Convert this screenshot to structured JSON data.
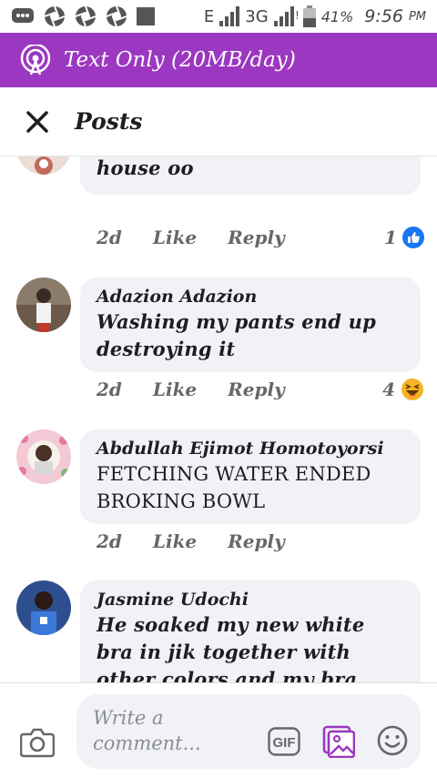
{
  "status_bar": {
    "network_type_1": "E",
    "network_type_2": "3G",
    "battery": "41%",
    "time": "9:56",
    "ampm": "PM"
  },
  "banner": {
    "text": "Text Only (20MB/day)",
    "icon": "free-mode-broadcast-icon",
    "color": "#9b37c0"
  },
  "header": {
    "title": "Posts",
    "close_icon": "close-icon"
  },
  "comments": [
    {
      "author": "",
      "text": "My can't  do anything in the house  oo",
      "time": "2d",
      "like_label": "Like",
      "reply_label": "Reply",
      "reaction_count": "1",
      "reaction_icon": "like-reaction-icon"
    },
    {
      "author": "Adazion Adazion",
      "text": "Washing my pants end up destroying it",
      "time": "2d",
      "like_label": "Like",
      "reply_label": "Reply",
      "reaction_count": "4",
      "reaction_icon": "haha-reaction-icon"
    },
    {
      "author": "Abdullah Ejimot Homotoyorsi",
      "text": "FETCHING WATER ENDED BROKING BOWL",
      "time": "2d",
      "like_label": "Like",
      "reply_label": "Reply",
      "reaction_count": "",
      "reaction_icon": ""
    },
    {
      "author": "Jasmine Udochi",
      "text": "He soaked my new white bra in jik together with other colors and my bra came out many",
      "time": "",
      "like_label": "",
      "reply_label": "",
      "reaction_count": "",
      "reaction_icon": ""
    }
  ],
  "composer": {
    "placeholder": "Write a comment...",
    "gif_label": "GIF",
    "camera_icon": "camera-icon",
    "image_icon": "image-icon",
    "emoji_icon": "emoji-icon"
  },
  "colors": {
    "accent": "#9b37c0",
    "bubble": "#f0f2f5",
    "meta_text": "#65676b",
    "like_blue": "#1877f2"
  }
}
